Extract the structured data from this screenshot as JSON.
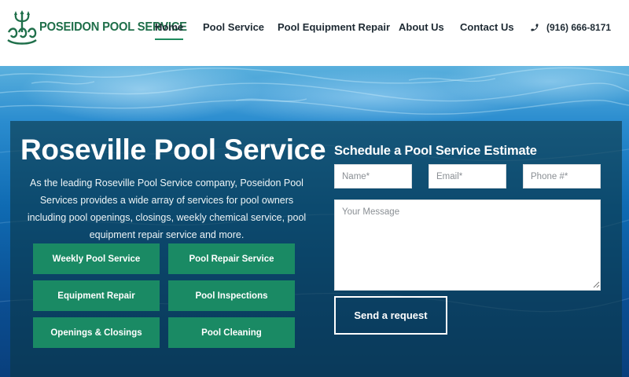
{
  "brand": {
    "name": "POSEIDON POOL SERVICE",
    "primary_color": "#1f6f4a",
    "accent_color": "#1a8a64",
    "logo_icon": "trident-waves-logo"
  },
  "nav": {
    "items": [
      {
        "label": "Home",
        "active": true
      },
      {
        "label": "Pool Service",
        "active": false
      },
      {
        "label": "Pool Equipment Repair",
        "active": false
      },
      {
        "label": "About Us",
        "active": false
      },
      {
        "label": "Contact Us",
        "active": false
      }
    ],
    "phone": "(916) 666-8171",
    "phone_icon": "phone-icon"
  },
  "hero": {
    "title": "Roseville Pool Service",
    "description": "As the leading Roseville Pool Service company, Poseidon Pool Services provides a wide array of services for pool owners including pool openings, closings, weekly chemical service, pool equipment repair service and more.",
    "services": [
      "Weekly Pool Service",
      "Pool Repair Service",
      "Equipment Repair",
      "Pool Inspections",
      "Openings & Closings",
      "Pool Cleaning"
    ]
  },
  "form": {
    "title": "Schedule a Pool Service Estimate",
    "name_placeholder": "Name*",
    "email_placeholder": "Email*",
    "phone_placeholder": "Phone #*",
    "message_placeholder": "Your Message",
    "submit_label": "Send a request"
  }
}
